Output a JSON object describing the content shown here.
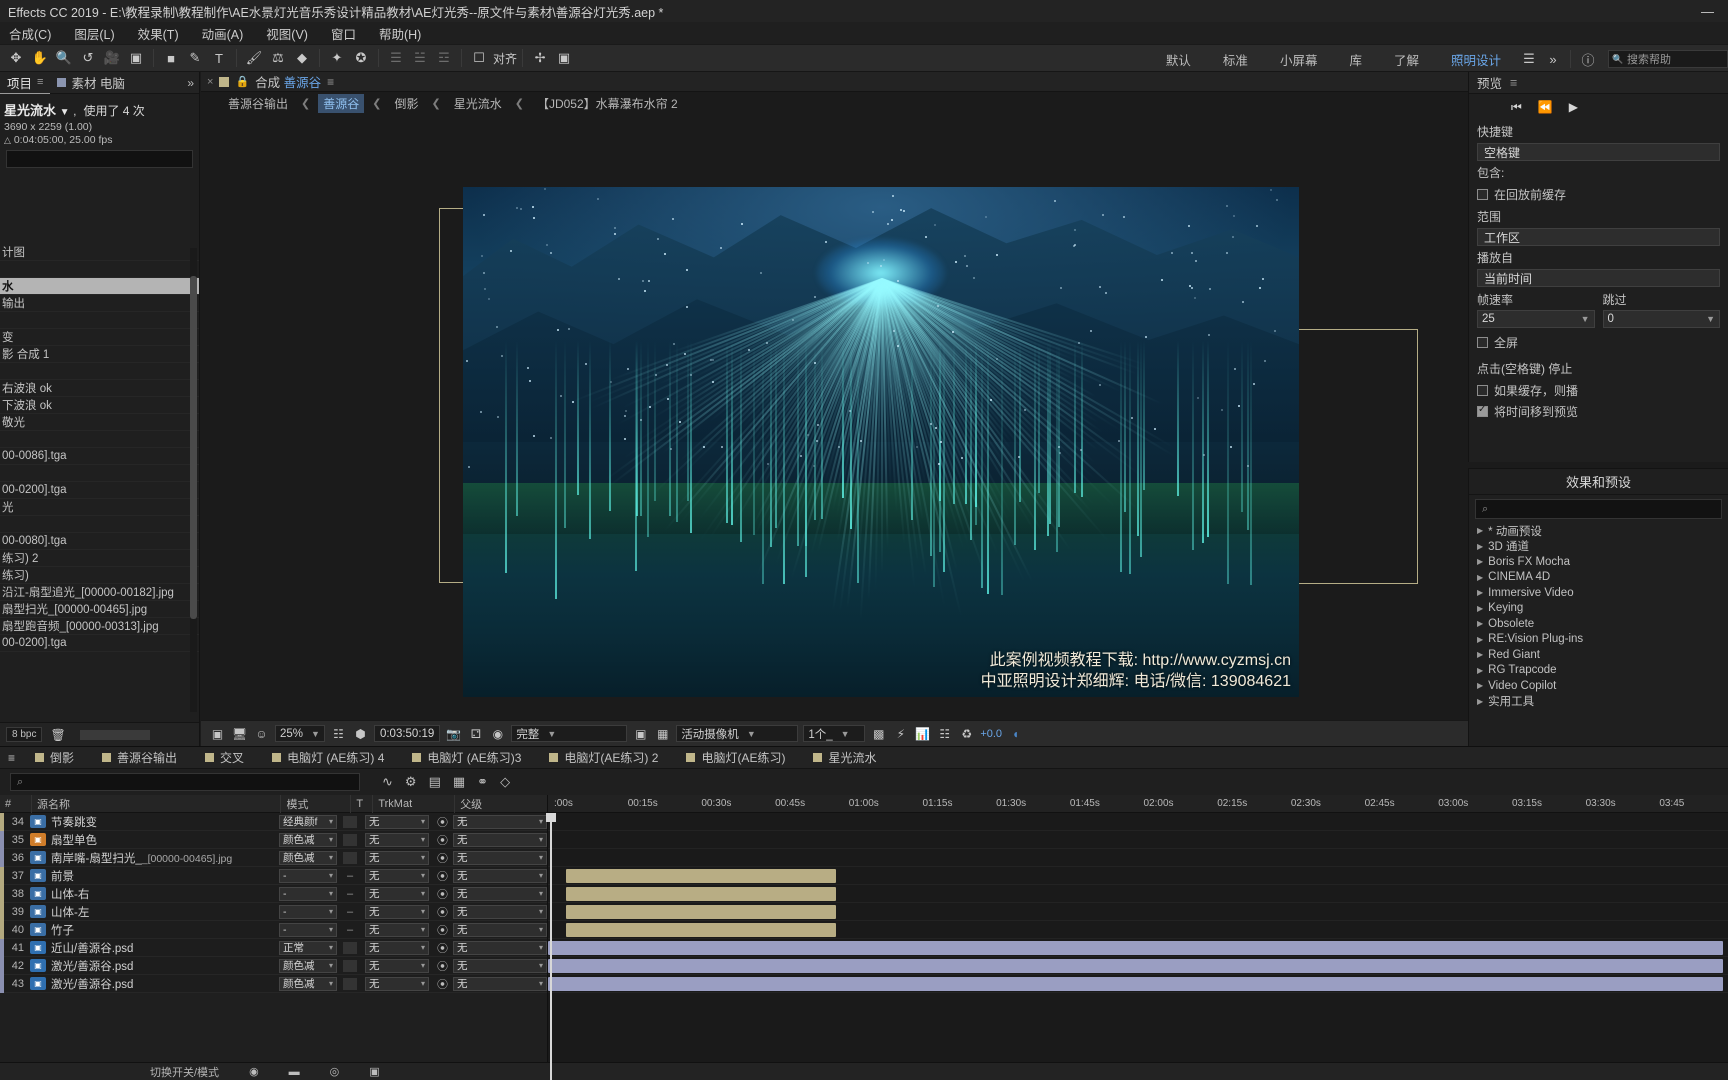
{
  "window": {
    "title": "Effects CC 2019 - E:\\教程录制\\教程制作\\AE水景灯光音乐秀设计精品教材\\AE灯光秀--原文件与素材\\善源谷灯光秀.aep *",
    "minimize": "—",
    "maximize": "▭",
    "close": "✕"
  },
  "menu": {
    "items": [
      "合成(C)",
      "图层(L)",
      "效果(T)",
      "动画(A)",
      "视图(V)",
      "窗口",
      "帮助(H)"
    ]
  },
  "toolbar": {
    "align_label": "对齐",
    "workspaces": [
      "默认",
      "标准",
      "小屏幕",
      "库",
      "了解",
      "照明设计"
    ],
    "active_workspace": "照明设计",
    "search_placeholder": "搜索帮助"
  },
  "project": {
    "tabs": [
      {
        "label": "项目",
        "active": true
      },
      {
        "label": "素材 电脑",
        "active": false
      }
    ],
    "item_name": "星光流水",
    "item_usage": "使用了 4 次",
    "item_size": "3690 x 2259 (1.00)",
    "item_duration": "0:04:05:00, 25.00 fps",
    "rows": [
      {
        "label": "计图",
        "selected": false
      },
      {
        "label": "",
        "selected": false
      },
      {
        "label": "水",
        "selected": true
      },
      {
        "label": "输出",
        "selected": false
      },
      {
        "label": "",
        "selected": false
      },
      {
        "label": "变",
        "selected": false
      },
      {
        "label": "影 合成 1",
        "selected": false
      },
      {
        "label": "",
        "selected": false
      },
      {
        "label": "右波浪 ok",
        "selected": false
      },
      {
        "label": "下波浪  ok",
        "selected": false
      },
      {
        "label": "敬光",
        "selected": false
      },
      {
        "label": "",
        "selected": false
      },
      {
        "label": "00-0086].tga",
        "selected": false
      },
      {
        "label": "",
        "selected": false
      },
      {
        "label": "00-0200].tga",
        "selected": false
      },
      {
        "label": "光",
        "selected": false
      },
      {
        "label": "",
        "selected": false
      },
      {
        "label": "00-0080].tga",
        "selected": false
      },
      {
        "label": "练习) 2",
        "selected": false
      },
      {
        "label": "练习)",
        "selected": false
      },
      {
        "label": "沿江-扇型追光_[00000-00182].jpg",
        "selected": false
      },
      {
        "label": "扇型扫光_[00000-00465].jpg",
        "selected": false
      },
      {
        "label": "扇型跑音频_[00000-00313].jpg",
        "selected": false
      },
      {
        "label": "00-0200].tga",
        "selected": false
      }
    ],
    "bpc": "8 bpc"
  },
  "composition": {
    "tab_prefix": "合成",
    "tab_name": "善源谷",
    "breadcrumbs": [
      {
        "label": "善源谷输出",
        "active": false
      },
      {
        "label": "善源谷",
        "active": true
      },
      {
        "label": "倒影",
        "active": false
      },
      {
        "label": "星光流水",
        "active": false
      },
      {
        "label": "【JD052】水幕瀑布水帘 2",
        "active": false
      }
    ],
    "watermark_line1": "此案例视频教程下载: http://www.cyzmsj.cn",
    "watermark_line2": "中亚照明设计郑细辉: 电话/微信: 139084621"
  },
  "viewer_bar": {
    "zoom": "25%",
    "timecode": "0:03:50:19",
    "resolution": "完整",
    "camera": "活动摄像机",
    "views": "1个_",
    "exposure": "+0.0"
  },
  "preview": {
    "title": "预览",
    "shortcut_label": "快捷键",
    "shortcut_value": "空格键",
    "include_label": "包含:",
    "cache_before_playback": "在回放前缓存",
    "range_label": "范围",
    "range_value": "工作区",
    "play_from_label": "播放自",
    "play_from_value": "当前时间",
    "framerate_label": "帧速率",
    "skip_label": "跳过",
    "framerate_value": "25",
    "skip_value": "0",
    "fullscreen_label": "全屏",
    "stop_note": "点击(空格键) 停止",
    "if_cached_label": "如果缓存，则播",
    "move_time_label": "将时间移到预览"
  },
  "effects_panel": {
    "title": "效果和预设",
    "search_placeholder": "",
    "items": [
      "* 动画预设",
      "3D 通道",
      "Boris FX Mocha",
      "CINEMA 4D",
      "Immersive Video",
      "Keying",
      "Obsolete",
      "RE:Vision Plug-ins",
      "Red Giant",
      "RG Trapcode",
      "Video Copilot",
      "实用工具"
    ]
  },
  "timeline": {
    "tabs": [
      {
        "label": "倒影",
        "active": false
      },
      {
        "label": "善源谷输出",
        "active": false
      },
      {
        "label": "交叉",
        "active": false
      },
      {
        "label": "电脑灯 (AE练习) 4",
        "active": false
      },
      {
        "label": "电脑灯 (AE练习)3",
        "active": false
      },
      {
        "label": "电脑灯(AE练习) 2",
        "active": false
      },
      {
        "label": "电脑灯(AE练习)",
        "active": false
      },
      {
        "label": "星光流水",
        "active": false
      }
    ],
    "columns": [
      "#",
      "源名称",
      "模式",
      "T",
      "TrkMat",
      "父级"
    ],
    "layers": [
      {
        "num": "34",
        "name": "节奏跳变",
        "mode": "经典颜f",
        "t": "box",
        "trkmat": "无",
        "parent": "无",
        "icon": "#3a6ea5",
        "barcolor": "tan"
      },
      {
        "num": "35",
        "name": "扇型单色",
        "mode": "颜色减 ",
        "t": "box",
        "trkmat": "无",
        "parent": "无",
        "icon": "#d07d2a",
        "barcolor": "violet"
      },
      {
        "num": "36",
        "name": "南岸嘴-扇型扫光_",
        "name_suffix": "[00000-00465].jpg",
        "mode": "颜色减 ",
        "t": "box",
        "trkmat": "无",
        "parent": "无",
        "icon": "#3a6ea5",
        "barcolor": "violet"
      },
      {
        "num": "37",
        "name": "前景",
        "mode": "-",
        "t": "dash",
        "trkmat": "无",
        "parent": "无",
        "icon": "#3a6ea5",
        "barcolor": "tan"
      },
      {
        "num": "38",
        "name": "山体-右",
        "mode": "-",
        "t": "dash",
        "trkmat": "无",
        "parent": "无",
        "icon": "#3a6ea5",
        "barcolor": "tan"
      },
      {
        "num": "39",
        "name": "山体-左",
        "mode": "-",
        "t": "dash",
        "trkmat": "无",
        "parent": "无",
        "icon": "#3a6ea5",
        "barcolor": "tan"
      },
      {
        "num": "40",
        "name": "竹子",
        "mode": "-",
        "t": "dash",
        "trkmat": "无",
        "parent": "无",
        "icon": "#3a6ea5",
        "barcolor": "tan"
      },
      {
        "num": "41",
        "name": "近山/善源谷.psd",
        "mode": "正常",
        "t": "box",
        "trkmat": "无",
        "parent": "无",
        "icon": "#2f6fb0",
        "barcolor": "violet"
      },
      {
        "num": "42",
        "name": "激光/善源谷.psd",
        "mode": "颜色减 ",
        "t": "box",
        "trkmat": "无",
        "parent": "无",
        "icon": "#2f6fb0",
        "barcolor": "violet"
      },
      {
        "num": "43",
        "name": "激光/善源谷.psd",
        "mode": "颜色减 ",
        "t": "box",
        "trkmat": "无",
        "parent": "无",
        "icon": "#2f6fb0",
        "barcolor": "violet"
      }
    ],
    "ruler_ticks": [
      ":00s",
      "00:15s",
      "00:30s",
      "00:45s",
      "01:00s",
      "01:15s",
      "01:30s",
      "01:45s",
      "02:00s",
      "02:15s",
      "02:30s",
      "02:45s",
      "03:00s",
      "03:15s",
      "03:30s",
      "03:45"
    ],
    "footer_label": "切换开关/模式"
  }
}
